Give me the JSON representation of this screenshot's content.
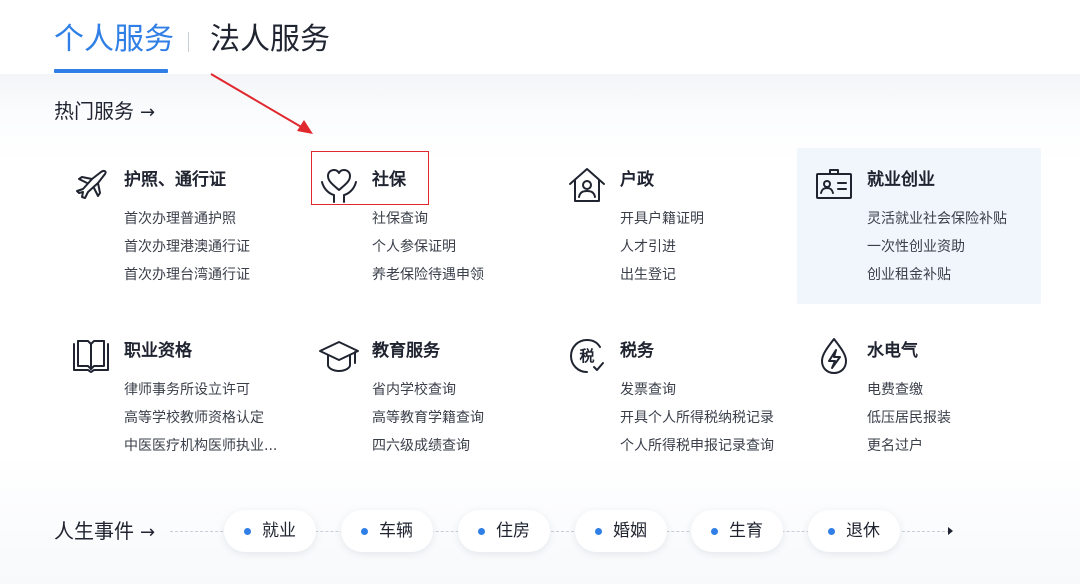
{
  "tabs": {
    "personal": "个人服务",
    "legal": "法人服务"
  },
  "hot_services": {
    "title": "热门服务",
    "arrow": "→",
    "cards": [
      {
        "icon": "airplane-icon",
        "title": "护照、通行证",
        "links": [
          "首次办理普通护照",
          "首次办理港澳通行证",
          "首次办理台湾通行证"
        ]
      },
      {
        "icon": "heart-hands-icon",
        "title": "社保",
        "links": [
          "社保查询",
          "个人参保证明",
          "养老保险待遇申领"
        ]
      },
      {
        "icon": "house-person-icon",
        "title": "户政",
        "links": [
          "开具户籍证明",
          "人才引进",
          "出生登记"
        ]
      },
      {
        "icon": "id-badge-icon",
        "title": "就业创业",
        "links": [
          "灵活就业社会保险补贴",
          "一次性创业资助",
          "创业租金补贴"
        ]
      },
      {
        "icon": "book-icon",
        "title": "职业资格",
        "links": [
          "律师事务所设立许可",
          "高等学校教师资格认定",
          "中医医疗机构医师执业..."
        ]
      },
      {
        "icon": "graduation-cap-icon",
        "title": "教育服务",
        "links": [
          "省内学校查询",
          "高等教育学籍查询",
          "四六级成绩查询"
        ]
      },
      {
        "icon": "tax-icon",
        "title": "税务",
        "links": [
          "发票查询",
          "开具个人所得税纳税记录",
          "个人所得税申报记录查询"
        ]
      },
      {
        "icon": "lightning-drop-icon",
        "title": "水电气",
        "links": [
          "电费查缴",
          "低压居民报装",
          "更名过户"
        ]
      }
    ],
    "tax_icon_glyph": "税"
  },
  "life_events": {
    "title": "人生事件",
    "arrow": "→",
    "items": [
      "就业",
      "车辆",
      "住房",
      "婚姻",
      "生育",
      "退休"
    ]
  },
  "colors": {
    "accent": "#2f7fe6",
    "text": "#1f2430",
    "annotation": "#e0282e",
    "highlight_bg": "#f1f6fc"
  }
}
